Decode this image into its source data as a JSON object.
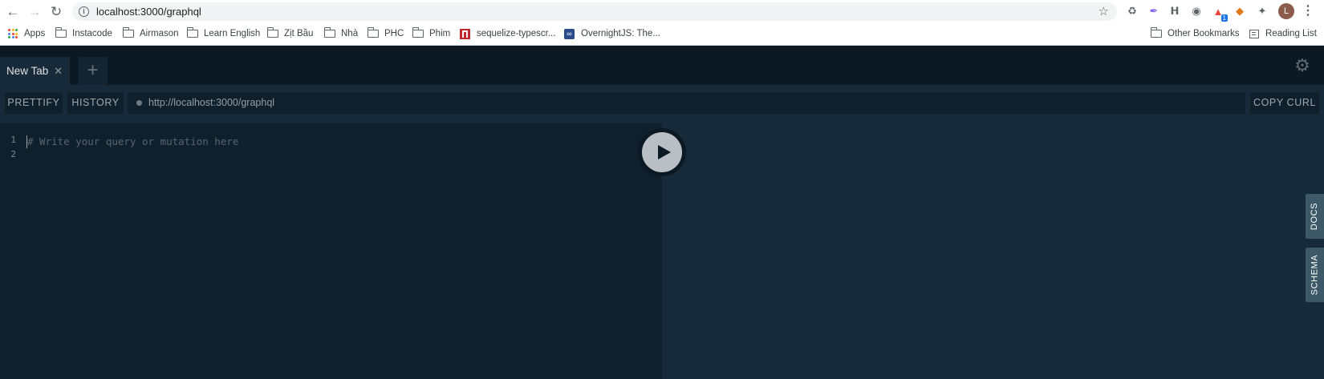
{
  "browser": {
    "url_host": "localhost",
    "url_rest": ":3000/graphql",
    "extension_badge": "1",
    "avatar_letter": "L",
    "bookmarks": [
      {
        "label": "Apps"
      },
      {
        "label": "Instacode"
      },
      {
        "label": "Airmason"
      },
      {
        "label": "Learn English"
      },
      {
        "label": "Zịt Bầu"
      },
      {
        "label": "Nhà"
      },
      {
        "label": "PHC"
      },
      {
        "label": "Phim"
      },
      {
        "label": "sequelize-typescr..."
      },
      {
        "label": "OvernightJS: The..."
      }
    ],
    "other_bookmarks": "Other Bookmarks",
    "reading_list": "Reading List"
  },
  "playground": {
    "tabs": [
      {
        "label": "New Tab"
      }
    ],
    "toolbar": {
      "prettify": "PRETTIFY",
      "history": "HISTORY",
      "endpoint": "http://localhost:3000/graphql",
      "copy_curl": "COPY CURL"
    },
    "editor": {
      "line_numbers": [
        "1",
        "2"
      ],
      "placeholder": "# Write your query or mutation here"
    },
    "side_tabs": {
      "docs": "DOCS",
      "schema": "SCHEMA"
    }
  },
  "colors": {
    "editor_bg": "#0f202d",
    "panel_bg": "#172a3a",
    "tabbar_bg": "#0b1924",
    "side_tab_bg": "#3d5866"
  }
}
